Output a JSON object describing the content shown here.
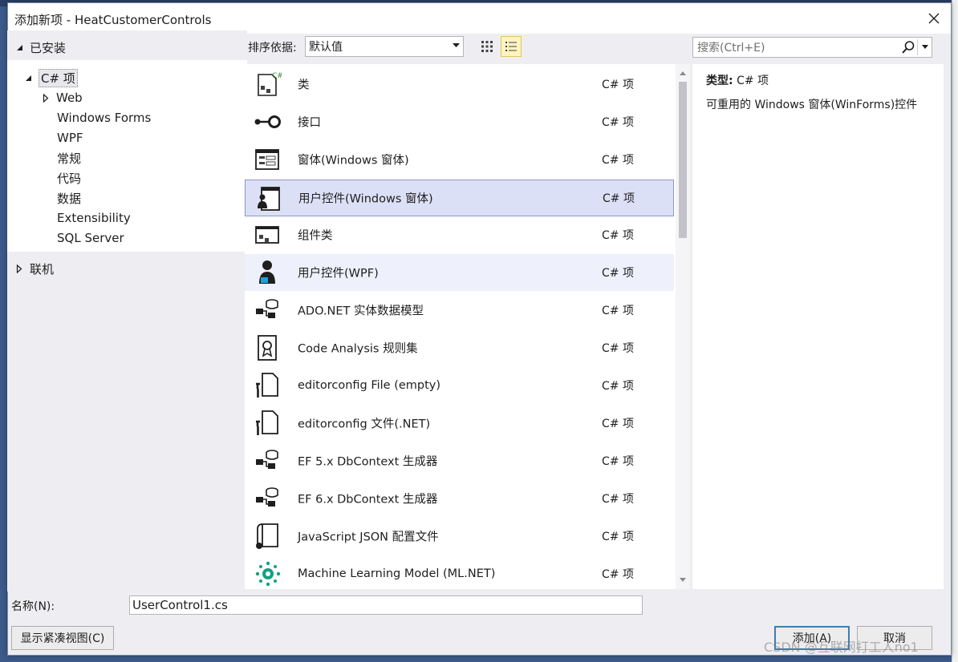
{
  "window": {
    "title": "添加新项 - HeatCustomerControls"
  },
  "tree": {
    "installed_label": "已安装",
    "root_label": "C# 项",
    "children": [
      "Web",
      "Windows Forms",
      "WPF",
      "常规",
      "代码",
      "数据",
      "Extensibility",
      "SQL Server"
    ],
    "online_label": "联机"
  },
  "toolbar": {
    "sort_label": "排序依据:",
    "sort_value": "默认值",
    "search_placeholder": "搜索(Ctrl+E)"
  },
  "templates": [
    {
      "name": "类",
      "lang": "C# 项",
      "icon": "class-icon"
    },
    {
      "name": "接口",
      "lang": "C# 项",
      "icon": "interface-icon"
    },
    {
      "name": "窗体(Windows 窗体)",
      "lang": "C# 项",
      "icon": "windows-form-icon"
    },
    {
      "name": "用户控件(Windows 窗体)",
      "lang": "C# 项",
      "icon": "user-control-icon"
    },
    {
      "name": "组件类",
      "lang": "C# 项",
      "icon": "component-class-icon"
    },
    {
      "name": "用户控件(WPF)",
      "lang": "C# 项",
      "icon": "wpf-user-control-icon"
    },
    {
      "name": "ADO.NET 实体数据模型",
      "lang": "C# 项",
      "icon": "entity-data-model-icon"
    },
    {
      "name": "Code Analysis 规则集",
      "lang": "C# 项",
      "icon": "ruleset-icon"
    },
    {
      "name": "editorconfig File (empty)",
      "lang": "C# 项",
      "icon": "editorconfig-icon"
    },
    {
      "name": "editorconfig 文件(.NET)",
      "lang": "C# 项",
      "icon": "editorconfig-net-icon"
    },
    {
      "name": "EF 5.x DbContext 生成器",
      "lang": "C# 项",
      "icon": "ef5-generator-icon"
    },
    {
      "name": "EF 6.x DbContext 生成器",
      "lang": "C# 项",
      "icon": "ef6-generator-icon"
    },
    {
      "name": "JavaScript JSON 配置文件",
      "lang": "C# 项",
      "icon": "json-config-icon"
    },
    {
      "name": "Machine Learning Model (ML.NET)",
      "lang": "C# 项",
      "icon": "ml-model-icon"
    }
  ],
  "details": {
    "type_label": "类型:",
    "type_value": "C# 项",
    "description": "可重用的 Windows 窗体(WinForms)控件"
  },
  "bottom": {
    "name_label": "名称(N):",
    "name_value": "UserControl1.cs",
    "compact_view_button": "显示紧凑视图(C)",
    "add_button": "添加(A)",
    "cancel_button": "取消"
  },
  "watermark": "CSDN @互联网打工人no1",
  "colors": {
    "accent": "#3c7fb1",
    "selection": "#dce0f7",
    "hover": "#eef0fb"
  }
}
